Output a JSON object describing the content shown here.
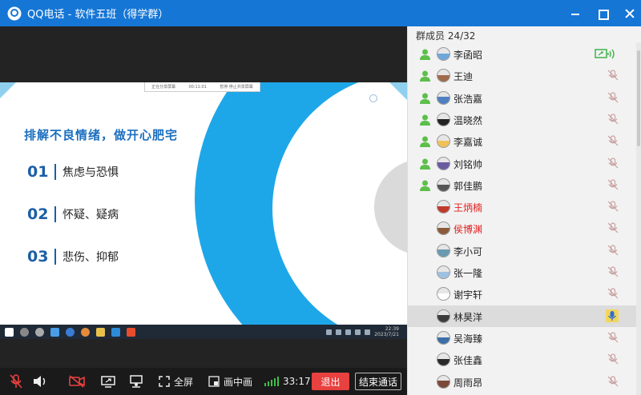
{
  "window": {
    "title": "QQ电话 - 软件五班（得学群）"
  },
  "slide": {
    "title": "排解不良情绪，做开心肥宅",
    "items": [
      {
        "num": "01",
        "text": "焦虑与恐惧"
      },
      {
        "num": "02",
        "text": "怀疑、疑病"
      },
      {
        "num": "03",
        "text": "悲伤、抑郁"
      }
    ],
    "toolbar_text": [
      "正在分享屏幕",
      "00:11:01",
      "暂停   停止共享屏幕"
    ],
    "taskbar_clock": [
      "22:39",
      "2023/7/21"
    ]
  },
  "controls": {
    "fullscreen_label": "全屏",
    "pip_label": "画中画",
    "duration": "33:17",
    "exit_label": "退出",
    "end_call_label": "结束通话"
  },
  "panel": {
    "header": "群成员 24/32",
    "members": [
      {
        "name": "李函昭",
        "status": "sharing",
        "red": false,
        "online": true,
        "avatar": "#6fa7d9"
      },
      {
        "name": "王迪",
        "status": "muted",
        "red": false,
        "online": true,
        "avatar": "#a06a4c"
      },
      {
        "name": "张浩嘉",
        "status": "muted",
        "red": false,
        "online": true,
        "avatar": "#4f7fbf"
      },
      {
        "name": "温晓然",
        "status": "muted",
        "red": false,
        "online": true,
        "avatar": "#222"
      },
      {
        "name": "李嘉诚",
        "status": "muted",
        "red": false,
        "online": true,
        "avatar": "#f0c15a"
      },
      {
        "name": "刘铭帅",
        "status": "muted",
        "red": false,
        "online": true,
        "avatar": "#6a5aa0"
      },
      {
        "name": "郭佳鹏",
        "status": "muted",
        "red": false,
        "online": true,
        "avatar": "#555"
      },
      {
        "name": "王炳楠",
        "status": "muted",
        "red": true,
        "online": false,
        "avatar": "#c0392b"
      },
      {
        "name": "侯博渊",
        "status": "muted",
        "red": true,
        "online": false,
        "avatar": "#8a5a3a"
      },
      {
        "name": "李小可",
        "status": "muted",
        "red": false,
        "online": false,
        "avatar": "#6a9ab0"
      },
      {
        "name": "张一隆",
        "status": "muted",
        "red": false,
        "online": false,
        "avatar": "#9fc0e0"
      },
      {
        "name": "谢宇轩",
        "status": "muted",
        "red": false,
        "online": false,
        "avatar": "#fff"
      },
      {
        "name": "林昊洋",
        "status": "speaking",
        "red": false,
        "online": false,
        "avatar": "#3c3c3c"
      },
      {
        "name": "吴海臻",
        "status": "muted",
        "red": false,
        "online": false,
        "avatar": "#3a6ea8"
      },
      {
        "name": "张佳鑫",
        "status": "muted",
        "red": false,
        "online": false,
        "avatar": "#2a2a2a"
      },
      {
        "name": "周雨昂",
        "status": "muted",
        "red": false,
        "online": false,
        "avatar": "#7a4a3a"
      }
    ]
  },
  "colors": {
    "titlebar": "#1576d6",
    "exit_button": "#e8413f",
    "slide_blue": "#1ea7e8",
    "signal_green": "#3fc04a",
    "speaking_highlight": "#f4d55a"
  }
}
